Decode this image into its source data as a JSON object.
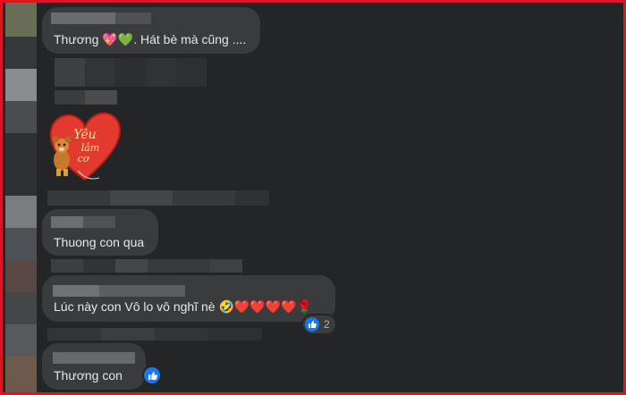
{
  "comments": [
    {
      "text": "Thương 💖💚. Hát bè mà cũng ...."
    },
    {
      "text": "Thuong con qua"
    },
    {
      "text": "Lúc này con Vô lo vô nghĩ nè 🤣❤️❤️❤️❤️🌹",
      "reaction_count": "2"
    },
    {
      "text": "Thương con"
    }
  ],
  "sticker": {
    "text": "YÊU LẮM CƠ"
  },
  "icons": {
    "like": "like-icon",
    "sticker": "heart-sticker-icon"
  },
  "colors": {
    "frame_border": "#e0141e",
    "background": "#242526",
    "bubble": "#3a3b3c",
    "text": "#e4e6eb",
    "like_blue": "#1877f2",
    "heart_red": "#e23a2e"
  }
}
